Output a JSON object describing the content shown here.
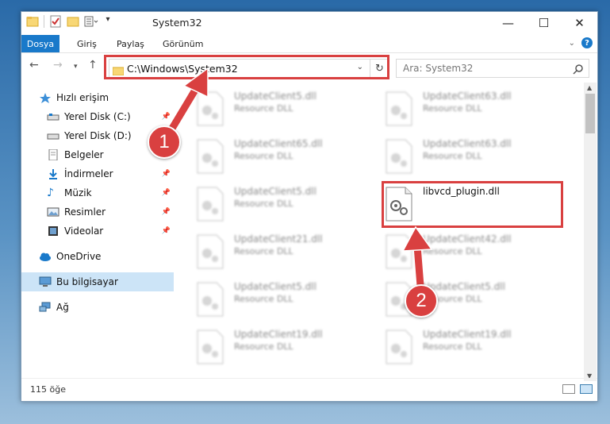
{
  "window": {
    "title": "System32"
  },
  "ribbon": {
    "tabs": [
      {
        "label": "Dosya"
      },
      {
        "label": "Giriş"
      },
      {
        "label": "Paylaş"
      },
      {
        "label": "Görünüm"
      }
    ]
  },
  "address": {
    "path": "C:\\Windows\\System32"
  },
  "search": {
    "placeholder": "Ara: System32"
  },
  "sidebar": {
    "items": [
      {
        "label": "Hızlı erişim",
        "icon": "star-icon"
      },
      {
        "label": "Yerel Disk (C:)",
        "icon": "drive-icon"
      },
      {
        "label": "Yerel Disk (D:)",
        "icon": "drive-icon"
      },
      {
        "label": "Belgeler",
        "icon": "documents-icon"
      },
      {
        "label": "İndirmeler",
        "icon": "download-icon"
      },
      {
        "label": "Müzik",
        "icon": "music-icon"
      },
      {
        "label": "Resimler",
        "icon": "pictures-icon"
      },
      {
        "label": "Videolar",
        "icon": "video-icon"
      },
      {
        "label": "OneDrive",
        "icon": "cloud-icon"
      },
      {
        "label": "Bu bilgisayar",
        "icon": "computer-icon"
      },
      {
        "label": "Ağ",
        "icon": "network-icon"
      }
    ]
  },
  "files": [
    {
      "name": "UpdateClient5.dll",
      "type": "Resource DLL"
    },
    {
      "name": "UpdateClient63.dll",
      "type": "Resource DLL"
    },
    {
      "name": "UpdateClient65.dll",
      "type": "Resource DLL"
    },
    {
      "name": "UpdateClient63.dll",
      "type": "Resource DLL"
    },
    {
      "name": "UpdateClient5.dll",
      "type": "Resource DLL"
    },
    {
      "name": "libvcd_plugin.dll",
      "type": ""
    },
    {
      "name": "UpdateClient21.dll",
      "type": "Resource DLL"
    },
    {
      "name": "UpdateClient42.dll",
      "type": "Resource DLL"
    },
    {
      "name": "UpdateClient5.dll",
      "type": "Resource DLL"
    },
    {
      "name": "UpdateClient5.dll",
      "type": "Resource DLL"
    },
    {
      "name": "UpdateClient19.dll",
      "type": "Resource DLL"
    },
    {
      "name": "UpdateClient19.dll",
      "type": "Resource DLL"
    }
  ],
  "status": {
    "count": "115 öğe"
  },
  "callouts": {
    "one": "1",
    "two": "2"
  },
  "colors": {
    "accent": "#1979ca",
    "highlight": "#d94040",
    "selected": "#cce4f7"
  }
}
